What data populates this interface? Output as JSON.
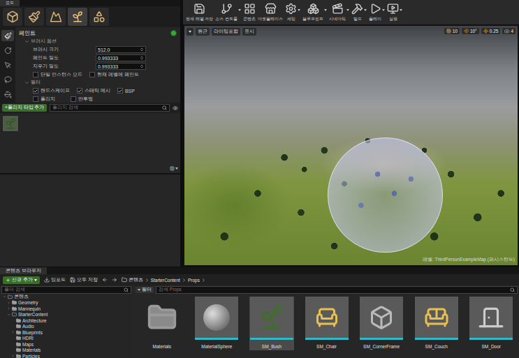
{
  "mode_panel": {
    "title": "모드",
    "modes": [
      {
        "name": "place",
        "selected": false
      },
      {
        "name": "paint",
        "selected": false
      },
      {
        "name": "landscape",
        "selected": false
      },
      {
        "name": "foliage",
        "selected": true
      },
      {
        "name": "geometry",
        "selected": false
      }
    ]
  },
  "tools": [
    {
      "name": "paint",
      "selected": true
    },
    {
      "name": "reapply",
      "selected": false
    },
    {
      "name": "select",
      "selected": false
    },
    {
      "name": "lasso",
      "selected": false
    },
    {
      "name": "fill",
      "selected": false
    }
  ],
  "details": {
    "title": "페인트",
    "brush_section": "브러시 옵션",
    "fields": [
      {
        "label": "브러시 크기",
        "value": "512.0"
      },
      {
        "label": "페인트 밀도",
        "value": "0.993333"
      },
      {
        "label": "지우기 밀도",
        "value": "0.993333"
      }
    ],
    "options": [
      {
        "label": "단일 인스턴스 모드",
        "checked": false
      },
      {
        "label": "현재 레벨에 페인트",
        "checked": false
      }
    ],
    "filter_section": "필터",
    "filters": [
      {
        "label": "랜드스케이프",
        "checked": true
      },
      {
        "label": "스태틱 메시",
        "checked": true
      },
      {
        "label": "BSP",
        "checked": true
      },
      {
        "label": "폴리지",
        "checked": false
      },
      {
        "label": "반투명",
        "checked": false
      }
    ]
  },
  "foliage": {
    "add_button": "+폴리지 타입 추가",
    "search_placeholder": "폴리지 검색",
    "items": [
      {
        "selected": false
      }
    ]
  },
  "toolbar": [
    {
      "label": "현재 레벨 저장",
      "dropdown": false
    },
    {
      "label": "소스 컨트롤",
      "dropdown": true
    },
    {
      "label": "콘텐츠",
      "dropdown": false
    },
    {
      "label": "마켓플레이스",
      "dropdown": false
    },
    {
      "label": "세팅",
      "dropdown": true
    },
    {
      "label": "블루프린트",
      "dropdown": true
    },
    {
      "label": "시네마틱",
      "dropdown": true
    },
    {
      "label": "빌드",
      "dropdown": true
    },
    {
      "label": "플레이",
      "dropdown": true
    },
    {
      "label": "실행",
      "dropdown": true
    }
  ],
  "viewport": {
    "view_buttons": [
      "원근",
      "라이팅포함",
      "표시"
    ],
    "snaps": [
      {
        "value": "10",
        "active": true
      },
      {
        "value": "10°",
        "active": true
      },
      {
        "value": "0.25",
        "active": true
      },
      {
        "value": "4",
        "active": false
      }
    ],
    "level_label": "레벨: ThirdPersonExampleMap (퍼시스턴트)"
  },
  "content_browser": {
    "tab": "콘텐츠 브라우저",
    "add_button": "신규 추가",
    "import_button": "임포트",
    "save_all_button": "모두 저장",
    "path": [
      "콘텐츠",
      "StarterContent",
      "Props"
    ],
    "folder_search": "폴더 검색",
    "filter_button": "필터",
    "asset_search": "검색 Props",
    "tree": [
      {
        "name": "콘텐츠",
        "depth": 0,
        "has_children": true,
        "expanded": true
      },
      {
        "name": "Geometry",
        "depth": 1,
        "has_children": true,
        "expanded": false
      },
      {
        "name": "Mannequin",
        "depth": 1,
        "has_children": true,
        "expanded": false
      },
      {
        "name": "StarterContent",
        "depth": 1,
        "has_children": true,
        "expanded": true
      },
      {
        "name": "Architecture",
        "depth": 2,
        "has_children": false,
        "expanded": false
      },
      {
        "name": "Audio",
        "depth": 2,
        "has_children": false,
        "expanded": false
      },
      {
        "name": "Blueprints",
        "depth": 2,
        "has_children": true,
        "expanded": false
      },
      {
        "name": "HDRI",
        "depth": 2,
        "has_children": false,
        "expanded": false
      },
      {
        "name": "Maps",
        "depth": 2,
        "has_children": false,
        "expanded": false
      },
      {
        "name": "Materials",
        "depth": 2,
        "has_children": false,
        "expanded": false
      },
      {
        "name": "Particles",
        "depth": 2,
        "has_children": true,
        "expanded": false
      }
    ],
    "assets": [
      {
        "name": "Materials",
        "kind": "folder",
        "selected": false
      },
      {
        "name": "MaterialSphere",
        "kind": "sphere",
        "selected": false
      },
      {
        "name": "SM_Bush",
        "kind": "bush",
        "selected": true
      },
      {
        "name": "SM_Chair",
        "kind": "chair",
        "selected": false
      },
      {
        "name": "SM_CornerFrame",
        "kind": "frame",
        "selected": false
      },
      {
        "name": "SM_Couch",
        "kind": "couch",
        "selected": false
      },
      {
        "name": "SM_Door",
        "kind": "door",
        "selected": false
      }
    ]
  }
}
